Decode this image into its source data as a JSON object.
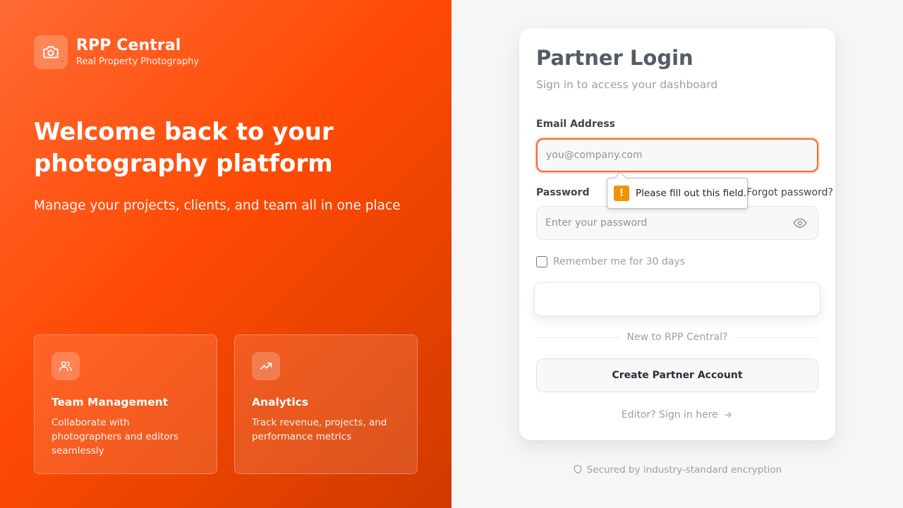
{
  "brand": {
    "name": "RPP Central",
    "subtitle": "Real Property Photography",
    "logo_icon": "camera-icon"
  },
  "hero": {
    "title": "Welcome back to your photography platform",
    "subtitle": "Manage your projects, clients, and team all in one place"
  },
  "features": [
    {
      "icon": "users-icon",
      "title": "Team Management",
      "description": "Collaborate with photographers and editors seamlessly"
    },
    {
      "icon": "trending-up-icon",
      "title": "Analytics",
      "description": "Track revenue, projects, and performance metrics"
    }
  ],
  "login": {
    "title": "Partner Login",
    "subtitle": "Sign in to access your dashboard",
    "email_label": "Email Address",
    "email_placeholder": "you@company.com",
    "email_value": "",
    "password_label": "Password",
    "forgot_label": "Forgot password?",
    "password_placeholder": "Enter your password",
    "password_value": "",
    "remember_label": "Remember me for 30 days",
    "remember_checked": false,
    "signin_label": "",
    "divider_text": "New to RPP Central?",
    "create_label": "Create Partner Account",
    "editor_link": "Editor? Sign in here"
  },
  "validation": {
    "message": "Please fill out this field.",
    "icon_glyph": "!"
  },
  "footer": {
    "secure_text": "Secured by industry-standard encryption"
  },
  "colors": {
    "brand_orange": "#ff4a05",
    "focus_ring": "#f4692e",
    "warning": "#f39200"
  }
}
